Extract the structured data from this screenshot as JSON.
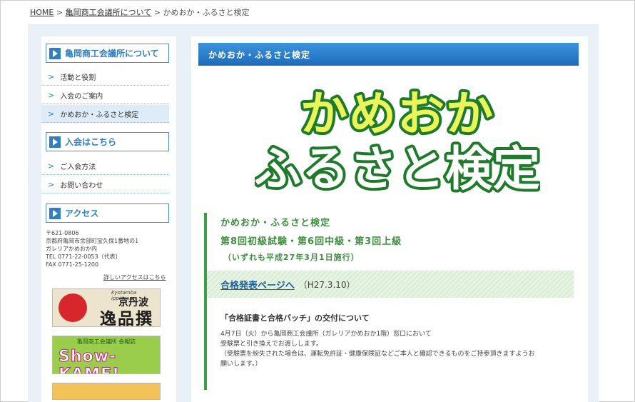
{
  "breadcrumb": {
    "home": "HOME",
    "sep1": " > ",
    "parent": "亀岡商工会議所について",
    "sep2": " > ",
    "current": "かめおか・ふるさと検定"
  },
  "sidebar": {
    "section1": {
      "title": "亀岡商工会議所について",
      "items": [
        "活動と役割",
        "入会のご案内",
        "かめおか・ふるさと検定"
      ]
    },
    "section2": {
      "title": "入会はこちら",
      "items": [
        "ご入会方法",
        "お問い合わせ"
      ]
    },
    "section3": {
      "title": "アクセス"
    },
    "address": [
      "〒621-0806",
      "京都府亀岡市余部町宝久保1番地の1",
      "ガレリアかめおか内",
      "TEL 0771-22-0053（代表）",
      "FAX 0771-25-1200"
    ],
    "access_link": "詳しいアクセスはこちら",
    "banner1": {
      "title_small": "Kyotamba ippincom",
      "title_big": "京丹波",
      "main": "逸品撰"
    },
    "banner2": {
      "top": "亀岡商工会議所 会報誌",
      "main": "Show-KAME!"
    }
  },
  "main": {
    "header": "かめおか・ふるさと検定",
    "logo": {
      "line1": "かめおか",
      "line2": "ふるさと検定"
    },
    "info_title": "かめおか・ふるさと検定",
    "info_rounds": "第8回初級試験・第6回中級・第3回上級",
    "info_date": "（いずれも平成27年3月1日施行）",
    "pass_link": "合格発表ページへ",
    "pass_date": "（H27.3.10）",
    "notice_title": "「合格証書と合格バッチ」の交付について",
    "notice_lines": [
      "4月7日（火）から亀岡商工会議所（ガレリアかめおか1階）窓口において",
      "受験票と引き換えでお渡しします。",
      "（受験票を紛失された場合は、運転免許証・健康保険証などご本人と確認できるものをご持参頂きますようお",
      "願いします。）"
    ]
  },
  "colors": {
    "accent_blue": "#2f7fc4",
    "accent_green": "#3e8f3f",
    "logo_fill": "#e9f55a",
    "logo_stroke": "#1f7a2b"
  }
}
